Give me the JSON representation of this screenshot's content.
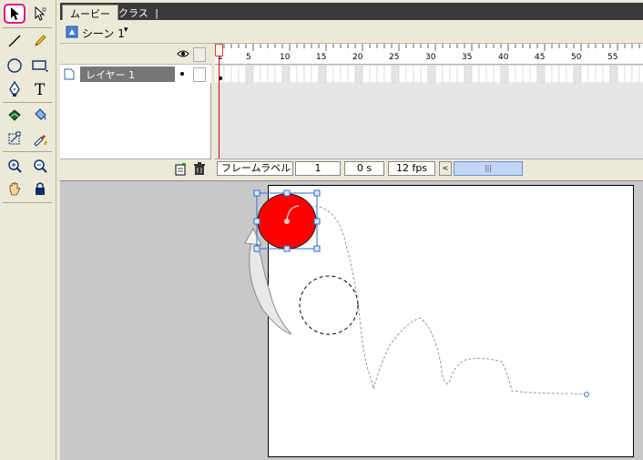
{
  "tabs": {
    "movie": "ムービー",
    "class": "クラス",
    "divider": "|"
  },
  "scene": {
    "label": "シーン 1",
    "dropdown_arrow": "▾"
  },
  "layer": {
    "name": "レイヤー 1"
  },
  "ruler": {
    "labels": [
      "1",
      "5",
      "10",
      "15",
      "20",
      "25",
      "30",
      "35",
      "40",
      "45",
      "50",
      "55"
    ]
  },
  "status": {
    "frame_label": "フレームラベル",
    "frame_number": "1",
    "time": "0 s",
    "fps": "12 fps",
    "scroll_left": "<",
    "scroll_grip": "|||"
  },
  "tools": [
    "arrow-tool",
    "subselect-tool",
    "line-tool",
    "pencil-tool",
    "oval-tool",
    "rectangle-tool",
    "pen-tool",
    "text-tool",
    "ink-bottle-tool",
    "paint-bucket-tool",
    "free-transform-tool",
    "eyedropper-tool",
    "zoom-in-tool",
    "zoom-out-tool",
    "hand-tool",
    "lock-tool"
  ],
  "colors": {
    "selection_highlight": "#e0168a",
    "ball_fill": "#ff0000",
    "selection_box": "#2b6fd6",
    "stage": "#ffffff",
    "workarea": "#c8c8c8",
    "playhead": "#d00000"
  }
}
